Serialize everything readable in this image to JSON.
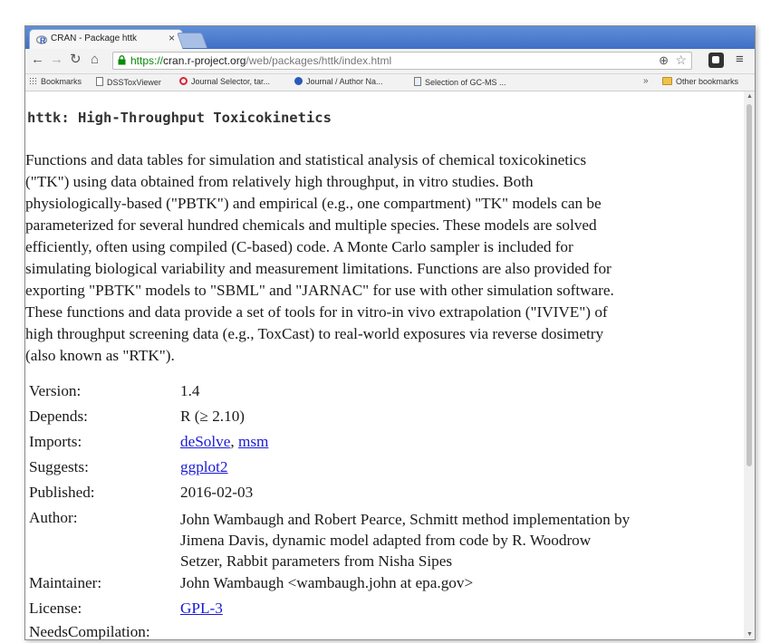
{
  "browser": {
    "tab_title": "CRAN - Package httk",
    "tab_close": "×",
    "url_scheme": "https://",
    "url_host": "cran.r-project.org",
    "url_path": "/web/packages/httk/index.html",
    "bookmarks": [
      {
        "label": "Bookmarks",
        "icon": "apps-icon"
      },
      {
        "label": "DSSToxViewer",
        "icon": "page-icon"
      },
      {
        "label": "Journal Selector, tar...",
        "icon": "journal-icon"
      },
      {
        "label": "Journal / Author Na...",
        "icon": "circle-icon"
      },
      {
        "label": "Selection of GC-MS ...",
        "icon": "page-icon"
      }
    ],
    "bookmarks_more": "»",
    "other_bookmarks": "Other bookmarks",
    "colors": {
      "tabbar": "#4a7bd0",
      "secure": "#0a8a0a",
      "link": "#1a1ad6"
    }
  },
  "page": {
    "title": "httk: High-Throughput Toxicokinetics",
    "description_lines": [
      "Functions and data tables for simulation and statistical analysis of chemical toxicokinetics",
      "(\"TK\") using data obtained from relatively high throughput, in vitro studies. Both",
      "physiologically-based (\"PBTK\") and empirical (e.g., one compartment) \"TK\" models can be",
      "parameterized for several hundred chemicals and multiple species. These models are solved",
      "efficiently, often using compiled (C-based) code. A Monte Carlo sampler is included for",
      "simulating biological variability and measurement limitations. Functions are also provided for",
      "exporting \"PBTK\" models to \"SBML\" and \"JARNAC\" for use with other simulation software.",
      "These functions and data provide a set of tools for in vitro-in vivo extrapolation (\"IVIVE\") of",
      "high throughput screening data (e.g., ToxCast) to real-world exposures via reverse dosimetry",
      "(also known as \"RTK\")."
    ],
    "fields": {
      "version": {
        "label": "Version:",
        "value": "1.4"
      },
      "depends": {
        "label": "Depends:",
        "value": "R (≥ 2.10)"
      },
      "imports": {
        "label": "Imports:",
        "link1": "deSolve",
        "sep": ", ",
        "link2": "msm"
      },
      "suggests": {
        "label": "Suggests:",
        "link": "ggplot2"
      },
      "published": {
        "label": "Published:",
        "value": "2016-02-03"
      },
      "author": {
        "label": "Author:",
        "lines": [
          "John Wambaugh and Robert Pearce, Schmitt method implementation by",
          "Jimena Davis, dynamic model adapted from code by R. Woodrow",
          "Setzer, Rabbit parameters from Nisha Sipes"
        ]
      },
      "maintainer": {
        "label": "Maintainer:",
        "value": "John Wambaugh <wambaugh.john at epa.gov>"
      },
      "license": {
        "label": "License:",
        "link": "GPL-3"
      },
      "cutoff": {
        "label": "NeedsCompilation:"
      }
    }
  }
}
